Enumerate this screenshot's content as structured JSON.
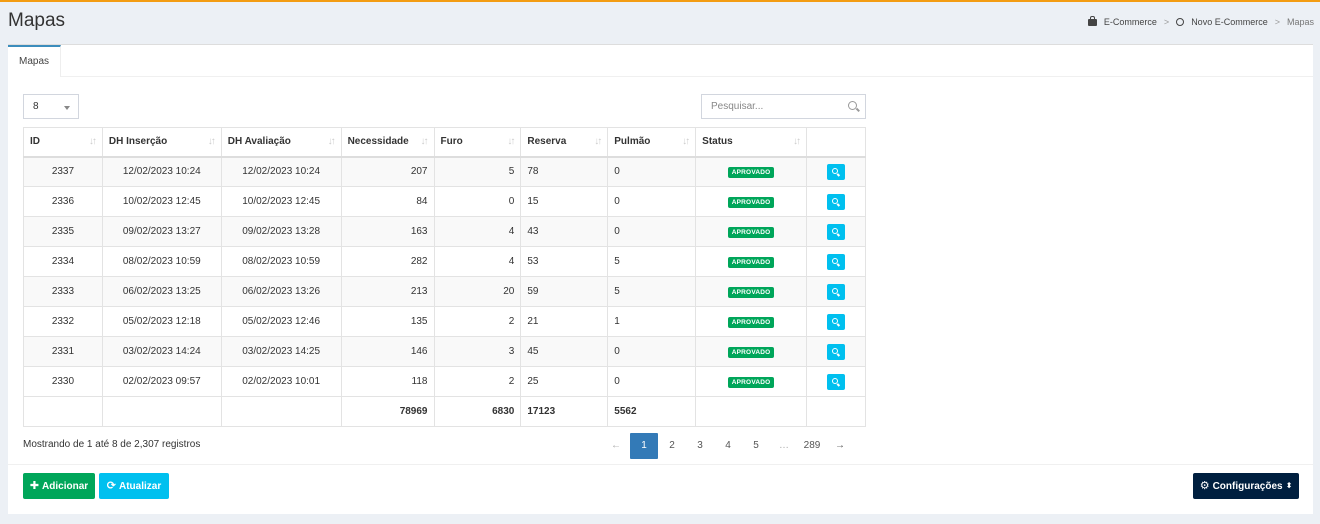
{
  "page": {
    "title": "Mapas"
  },
  "breadcrumb": {
    "items": [
      "E-Commerce",
      "Novo E-Commerce",
      "Mapas"
    ]
  },
  "tabs": [
    {
      "label": "Mapas"
    }
  ],
  "controls": {
    "page_length": "8",
    "search_placeholder": "Pesquisar..."
  },
  "table": {
    "headers": [
      "ID",
      "DH Inserção",
      "DH Avaliação",
      "Necessidade",
      "Furo",
      "Reserva",
      "Pulmão",
      "Status"
    ],
    "rows": [
      [
        "2337",
        "12/02/2023 10:24",
        "12/02/2023 10:24",
        "207",
        "5",
        "78",
        "0",
        "APROVADO"
      ],
      [
        "2336",
        "10/02/2023 12:45",
        "10/02/2023 12:45",
        "84",
        "0",
        "15",
        "0",
        "APROVADO"
      ],
      [
        "2335",
        "09/02/2023 13:27",
        "09/02/2023 13:28",
        "163",
        "4",
        "43",
        "0",
        "APROVADO"
      ],
      [
        "2334",
        "08/02/2023 10:59",
        "08/02/2023 10:59",
        "282",
        "4",
        "53",
        "5",
        "APROVADO"
      ],
      [
        "2333",
        "06/02/2023 13:25",
        "06/02/2023 13:26",
        "213",
        "20",
        "59",
        "5",
        "APROVADO"
      ],
      [
        "2332",
        "05/02/2023 12:18",
        "05/02/2023 12:46",
        "135",
        "2",
        "21",
        "1",
        "APROVADO"
      ],
      [
        "2331",
        "03/02/2023 14:24",
        "03/02/2023 14:25",
        "146",
        "3",
        "45",
        "0",
        "APROVADO"
      ],
      [
        "2330",
        "02/02/2023 09:57",
        "02/02/2023 10:01",
        "118",
        "2",
        "25",
        "0",
        "APROVADO"
      ]
    ],
    "totals": {
      "necessidade": "78969",
      "furo": "6830",
      "reserva": "17123",
      "pulmao": "5562"
    }
  },
  "info": "Mostrando de 1 até 8 de 2,307 registros",
  "pagination": {
    "prev": "←",
    "pages": [
      "1",
      "2",
      "3",
      "4",
      "5",
      "…",
      "289"
    ],
    "next": "→",
    "active": "1"
  },
  "buttons": {
    "add": "Adicionar",
    "refresh": "Atualizar",
    "config": "Configurações"
  },
  "colors": {
    "accent": "#f39c12",
    "primary": "#3c8dbc",
    "success": "#00a65a",
    "info": "#00c0ef",
    "navy": "#001f3f"
  }
}
